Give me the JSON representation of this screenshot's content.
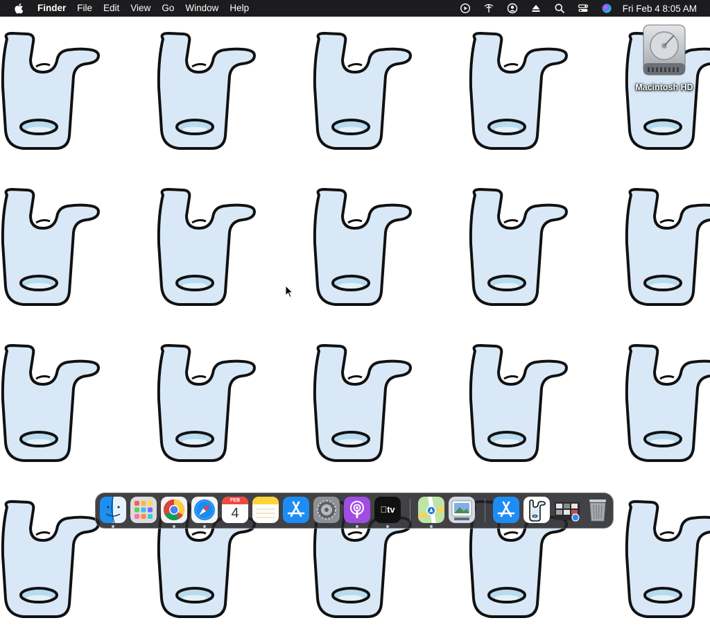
{
  "menubar": {
    "app_name": "Finder",
    "menus": [
      "File",
      "Edit",
      "View",
      "Go",
      "Window",
      "Help"
    ],
    "status_icons": [
      "screen-recording-icon",
      "wifi-icon",
      "user-account-icon",
      "eject-icon",
      "spotlight-search-icon",
      "control-center-icon",
      "siri-icon"
    ],
    "clock": "Fri Feb 4  8:05 AM"
  },
  "desktop": {
    "icons": [
      {
        "label": "Macintosh HD",
        "icon": "hard-drive-icon"
      }
    ],
    "wallpaper": "repeating-cartoon-hook-pattern"
  },
  "dock": {
    "apps": [
      {
        "name": "Finder",
        "icon": "finder-icon",
        "running": true
      },
      {
        "name": "Launchpad",
        "icon": "launchpad-icon",
        "running": false
      },
      {
        "name": "Google Chrome",
        "icon": "chrome-icon",
        "running": true
      },
      {
        "name": "Safari",
        "icon": "safari-icon",
        "running": true
      },
      {
        "name": "Calendar",
        "icon": "calendar-icon",
        "running": false,
        "month": "FEB",
        "day": "4"
      },
      {
        "name": "Notes",
        "icon": "notes-icon",
        "running": false
      },
      {
        "name": "App Store",
        "icon": "app-store-icon",
        "running": false
      },
      {
        "name": "System Preferences",
        "icon": "system-preferences-icon",
        "running": false
      },
      {
        "name": "Podcasts",
        "icon": "podcasts-icon",
        "running": true
      },
      {
        "name": "TV",
        "icon": "apple-tv-icon",
        "running": true,
        "label": "tv"
      },
      {
        "name": "Maps",
        "icon": "maps-icon",
        "running": true
      },
      {
        "name": "Preview",
        "icon": "preview-icon",
        "running": false
      },
      {
        "name": "App Store",
        "icon": "app-store-icon",
        "running": false
      },
      {
        "name": "Image",
        "icon": "hook-image-icon",
        "running": false
      },
      {
        "name": "Screenshots",
        "icon": "screenshots-folder-icon",
        "running": false
      },
      {
        "name": "Trash",
        "icon": "trash-icon",
        "running": false
      }
    ]
  },
  "colors": {
    "menubar_bg": "#1c1c1e",
    "hook_fill": "#d8e8f6",
    "hook_outline": "#111111",
    "dock_bg": "#232328"
  }
}
